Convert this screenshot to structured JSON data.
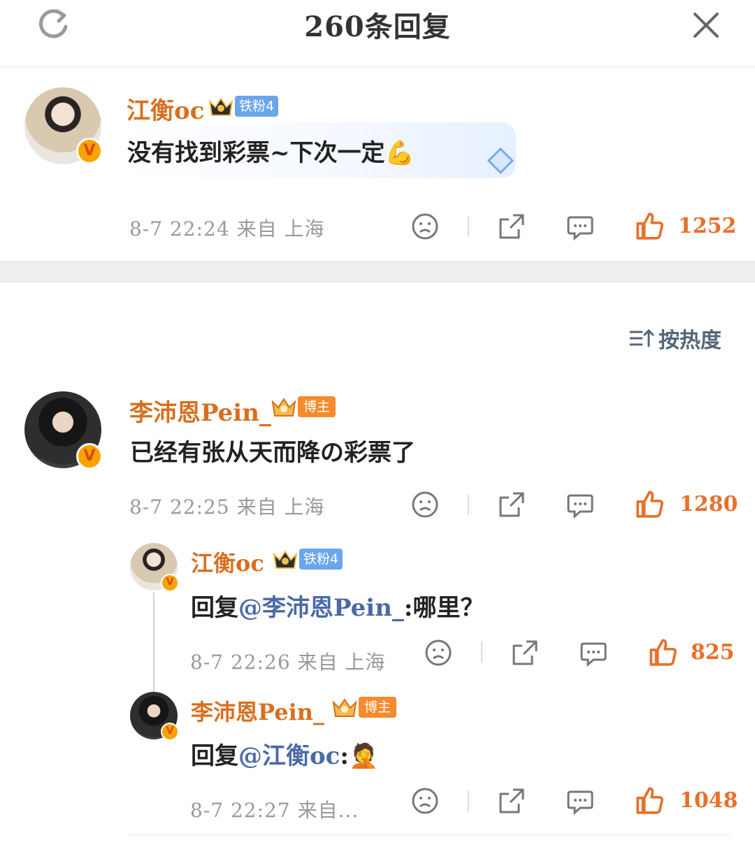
{
  "header": {
    "title": "260条回复"
  },
  "sort": {
    "label": "按热度"
  },
  "main_comment": {
    "username": "江衡oc",
    "fan_tag": "铁粉4",
    "text": "没有找到彩票~下次一定",
    "emoji": "💪",
    "meta": "8-7  22:24  来自  上海",
    "likes": "1252"
  },
  "replies": [
    {
      "username": "李沛恩Pein_",
      "tag": "博主",
      "text": "已经有张从天而降の彩票了",
      "meta": "8-7  22:25  来自  上海",
      "likes": "1280"
    },
    {
      "username": "江衡oc",
      "tag": "铁粉4",
      "reply_prefix": "回复",
      "mention": "@李沛恩Pein_",
      "text_tail": ":哪里？",
      "meta": "8-7  22:26  来自  上海",
      "likes": "825"
    },
    {
      "username": "李沛恩Pein_",
      "tag": "博主",
      "reply_prefix": "回复",
      "mention": "@江衡oc",
      "text_tail": ":",
      "emoji": "🤦",
      "meta": "8-7  22:27  来自...",
      "likes": "1048"
    }
  ],
  "colors": {
    "username": "#d86f1f",
    "like": "#e8702a",
    "mention": "#4a6aa5",
    "fan_tag": "#6aa6ec",
    "boss_tag": "#f58b2c"
  },
  "icons": [
    "refresh-icon",
    "close-icon",
    "dislike-face-icon",
    "share-icon",
    "comment-icon",
    "thumbs-up-icon",
    "sort-icon",
    "crown-icon",
    "verified-v-icon"
  ]
}
